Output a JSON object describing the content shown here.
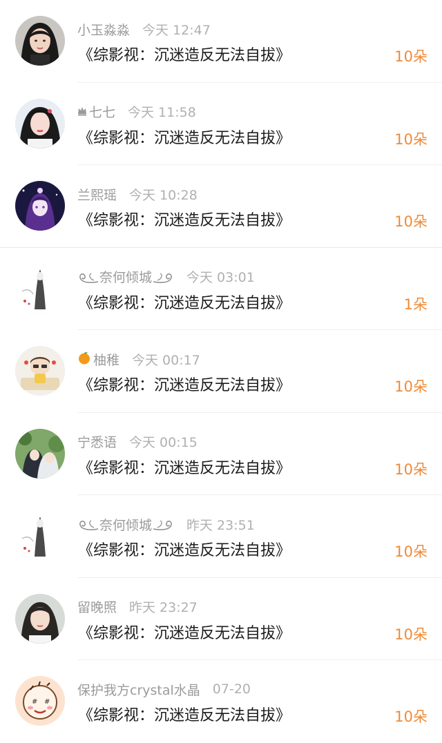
{
  "accent_color": "#ef8a37",
  "items": [
    {
      "name": "小玉淼淼",
      "time": "今天 12:47",
      "title": "《综影视：沉迷造反无法自拔》",
      "count": "10朵",
      "avatar": "woman-photo-avatar"
    },
    {
      "name": "七七",
      "prefix_icon": "crown-icon",
      "time": "今天 11:58",
      "title": "《综影视：沉迷造反无法自拔》",
      "count": "10朵",
      "avatar": "costume-girl-avatar"
    },
    {
      "name": "兰熙瑶",
      "time": "今天 10:28",
      "title": "《综影视：沉迷造反无法自拔》",
      "count": "10朵",
      "avatar": "anime-night-avatar"
    },
    {
      "name": "奈何倾城",
      "deco": "swirl-ornament",
      "time": "今天 03:01",
      "title": "《综影视：沉迷造反无法自拔》",
      "count": "1朵",
      "avatar": "ink-painting-avatar"
    },
    {
      "name": "柚稚",
      "prefix_icon": "orange-icon",
      "time": "今天 00:17",
      "title": "《综影视：沉迷造反无法自拔》",
      "count": "10朵",
      "avatar": "cartoon-kid-avatar"
    },
    {
      "name": "宁悉语",
      "time": "今天 00:15",
      "title": "《综影视：沉迷造反无法自拔》",
      "count": "10朵",
      "avatar": "anime-garden-avatar"
    },
    {
      "name": "奈何倾城",
      "deco": "swirl-ornament",
      "time": "昨天 23:51",
      "title": "《综影视：沉迷造反无法自拔》",
      "count": "10朵",
      "avatar": "ink-painting-avatar"
    },
    {
      "name": "留晚照",
      "time": "昨天 23:27",
      "title": "《综影视：沉迷造反无法自拔》",
      "count": "10朵",
      "avatar": "portrait-photo-avatar"
    },
    {
      "name": "保护我方crystal水晶",
      "time": "07-20",
      "title": "《综影视：沉迷造反无法自拔》",
      "count": "10朵",
      "avatar": "doodle-face-avatar"
    }
  ]
}
